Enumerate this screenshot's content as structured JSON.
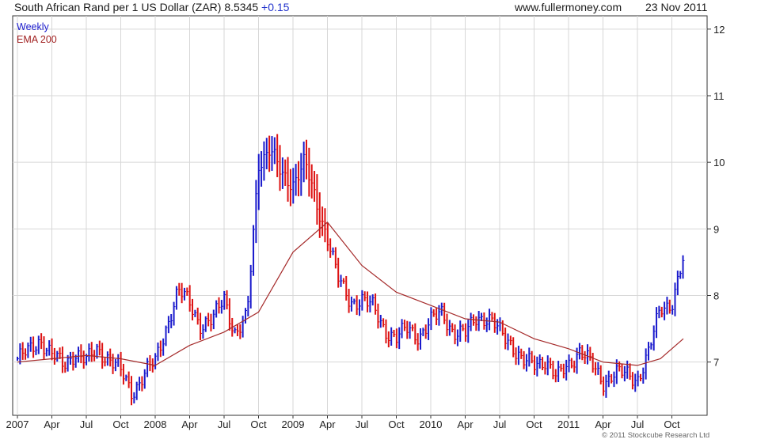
{
  "header": {
    "title": "South African Rand per 1 US Dollar (ZAR) 8.5345",
    "change": "+0.15",
    "source": "www.fullermoney.com",
    "date": "23 Nov 2011"
  },
  "legend": {
    "series1": "Weekly",
    "series2": "EMA 200"
  },
  "copyright": "© 2011 Stockcube Research Ltd",
  "colors": {
    "up": "#1a1acc",
    "down": "#dd1111",
    "ema": "#a52a2a",
    "grid": "#d7d7d7",
    "axis": "#333333"
  },
  "chart_data": {
    "type": "line",
    "ylim": [
      6.2,
      12.2
    ],
    "y_ticks": [
      "7",
      "8",
      "9",
      "10",
      "11",
      "12"
    ],
    "x_ticks": [
      "2007",
      "Apr",
      "Jul",
      "Oct",
      "2008",
      "Apr",
      "Jul",
      "Oct",
      "2009",
      "Apr",
      "Jul",
      "Oct",
      "2010",
      "Apr",
      "Jul",
      "Oct",
      "2011",
      "Apr",
      "Jul",
      "Oct"
    ],
    "x_range": [
      "2007-01",
      "2011-11"
    ],
    "series": [
      {
        "name": "Weekly",
        "style": "ohlc_bars",
        "points": [
          [
            "2007-01",
            7.05
          ],
          [
            "2007-02",
            7.15
          ],
          [
            "2007-03",
            7.35
          ],
          [
            "2007-04",
            7.1
          ],
          [
            "2007-05",
            6.95
          ],
          [
            "2007-06",
            7.15
          ],
          [
            "2007-07",
            7.0
          ],
          [
            "2007-08",
            7.2
          ],
          [
            "2007-09",
            7.05
          ],
          [
            "2007-10",
            6.85
          ],
          [
            "2007-11",
            6.55
          ],
          [
            "2007-12",
            6.8
          ],
          [
            "2008-01",
            7.0
          ],
          [
            "2008-02",
            7.55
          ],
          [
            "2008-03",
            8.05
          ],
          [
            "2008-04",
            7.9
          ],
          [
            "2008-05",
            7.55
          ],
          [
            "2008-06",
            7.6
          ],
          [
            "2008-07",
            8.0
          ],
          [
            "2008-08",
            7.4
          ],
          [
            "2008-09",
            7.65
          ],
          [
            "2008-10",
            10.0
          ],
          [
            "2008-11",
            10.2
          ],
          [
            "2008-12",
            9.8
          ],
          [
            "2009-01",
            9.7
          ],
          [
            "2009-02",
            10.0
          ],
          [
            "2009-03",
            9.4
          ],
          [
            "2009-04",
            8.9
          ],
          [
            "2009-05",
            8.2
          ],
          [
            "2009-06",
            7.9
          ],
          [
            "2009-07",
            7.95
          ],
          [
            "2009-08",
            7.8
          ],
          [
            "2009-09",
            7.5
          ],
          [
            "2009-10",
            7.35
          ],
          [
            "2009-11",
            7.5
          ],
          [
            "2009-12",
            7.4
          ],
          [
            "2010-01",
            7.6
          ],
          [
            "2010-02",
            7.75
          ],
          [
            "2010-03",
            7.45
          ],
          [
            "2010-04",
            7.4
          ],
          [
            "2010-05",
            7.7
          ],
          [
            "2010-06",
            7.65
          ],
          [
            "2010-07",
            7.45
          ],
          [
            "2010-08",
            7.3
          ],
          [
            "2010-09",
            7.0
          ],
          [
            "2010-10",
            6.95
          ],
          [
            "2010-11",
            7.05
          ],
          [
            "2010-12",
            6.75
          ],
          [
            "2011-01",
            6.95
          ],
          [
            "2011-02",
            7.2
          ],
          [
            "2011-03",
            6.95
          ],
          [
            "2011-04",
            6.7
          ],
          [
            "2011-05",
            6.85
          ],
          [
            "2011-06",
            6.8
          ],
          [
            "2011-07",
            6.75
          ],
          [
            "2011-08",
            7.15
          ],
          [
            "2011-09",
            7.8
          ],
          [
            "2011-10",
            7.9
          ],
          [
            "2011-11",
            8.53
          ]
        ]
      },
      {
        "name": "EMA 200",
        "style": "line",
        "points": [
          [
            "2007-01",
            7.0
          ],
          [
            "2007-04",
            7.05
          ],
          [
            "2007-07",
            7.1
          ],
          [
            "2007-10",
            7.05
          ],
          [
            "2008-01",
            6.95
          ],
          [
            "2008-04",
            7.25
          ],
          [
            "2008-07",
            7.45
          ],
          [
            "2008-10",
            7.75
          ],
          [
            "2009-01",
            8.65
          ],
          [
            "2009-04",
            9.1
          ],
          [
            "2009-07",
            8.45
          ],
          [
            "2009-10",
            8.05
          ],
          [
            "2010-01",
            7.85
          ],
          [
            "2010-04",
            7.65
          ],
          [
            "2010-07",
            7.6
          ],
          [
            "2010-10",
            7.35
          ],
          [
            "2011-01",
            7.2
          ],
          [
            "2011-04",
            7.0
          ],
          [
            "2011-07",
            6.95
          ],
          [
            "2011-09",
            7.05
          ],
          [
            "2011-11",
            7.35
          ]
        ]
      }
    ]
  }
}
